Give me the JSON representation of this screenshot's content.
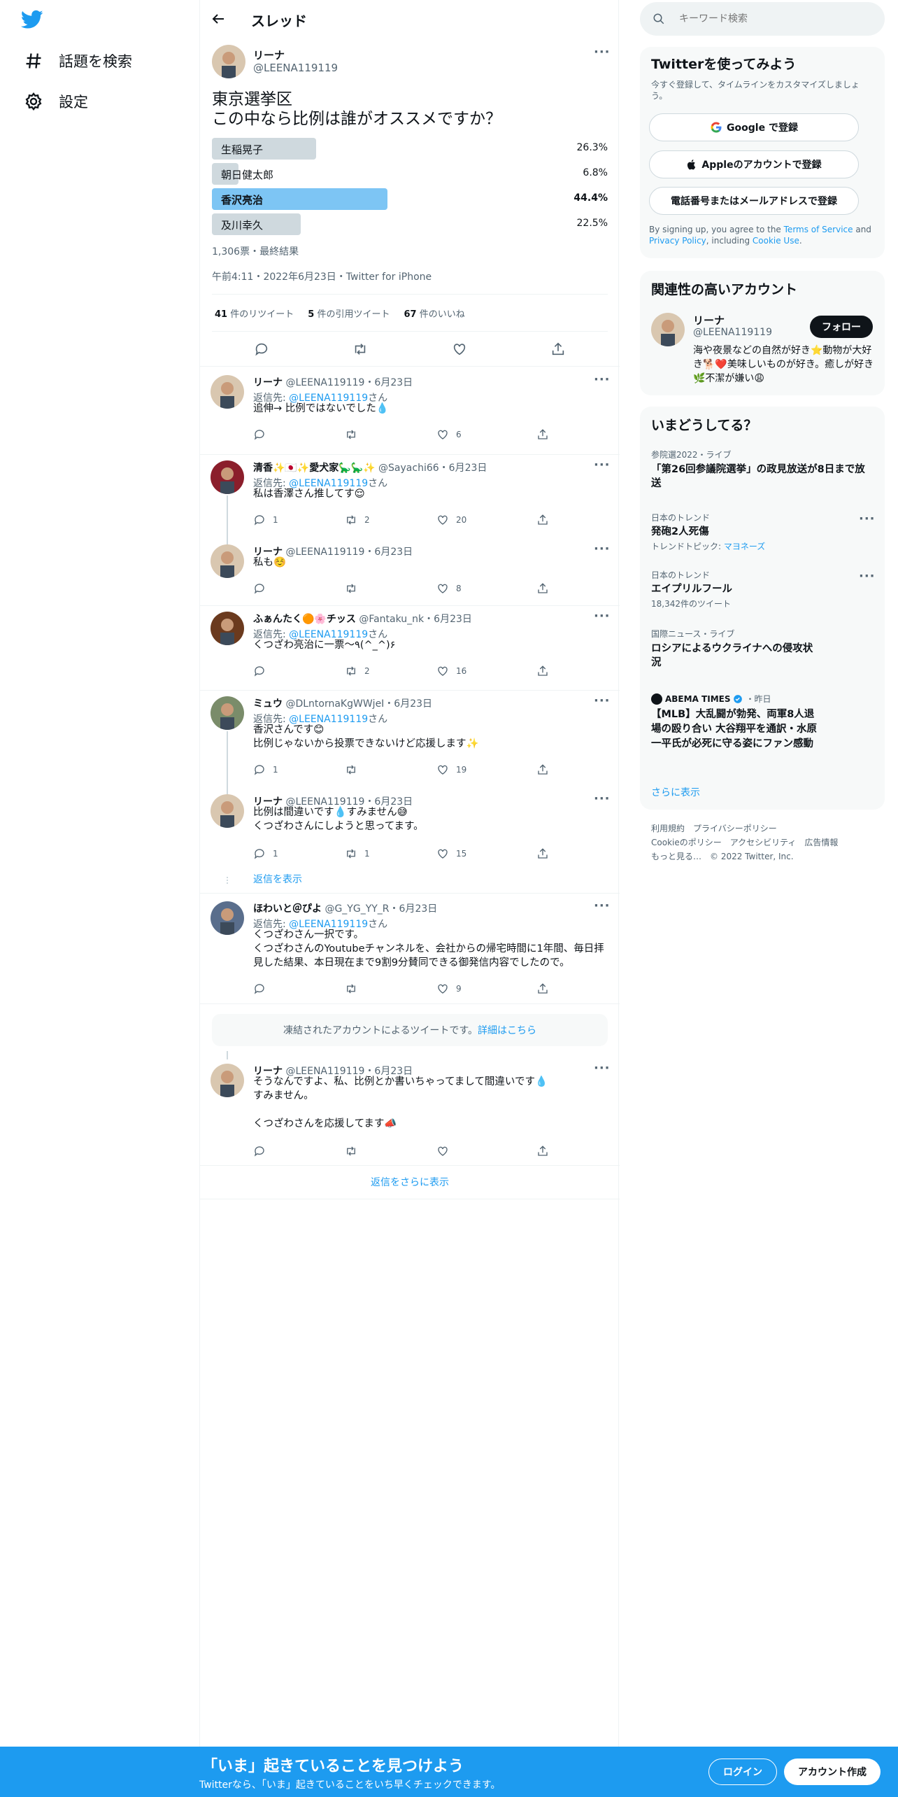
{
  "sidebar": {
    "explore_label": "話題を検索",
    "settings_label": "設定"
  },
  "header": {
    "title": "スレッド"
  },
  "focal": {
    "name": "リーナ",
    "handle": "@LEENA119119",
    "text_line1": "東京選挙区",
    "text_line2": "この中なら比例は誰がオススメですか？",
    "poll": [
      {
        "label": "生稲晃子",
        "percent": "26.3%",
        "value": 26.3,
        "winner": false
      },
      {
        "label": "朝日健太郎",
        "percent": "6.8%",
        "value": 6.8,
        "winner": false
      },
      {
        "label": "香沢亮治",
        "percent": "44.4%",
        "value": 44.4,
        "winner": true
      },
      {
        "label": "及川幸久",
        "percent": "22.5%",
        "value": 22.5,
        "winner": false
      }
    ],
    "votes": "1,306票・最終結果",
    "timestamp": "午前4:11・2022年6月23日・Twitter for iPhone",
    "retweets_count": "41",
    "retweets_label": "件のリツイート",
    "quotes_count": "5",
    "quotes_label": "件の引用ツイート",
    "likes_count": "67",
    "likes_label": "件のいいね"
  },
  "replies": [
    {
      "name": "リーナ",
      "handle": "@LEENA119119",
      "date": "・6月23日",
      "reply_prefix": "返信先: ",
      "reply_to": "@LEENA119119",
      "reply_suffix": "さん",
      "text": "追伸→ 比例ではないでした💧",
      "replies": "",
      "retweets": "",
      "likes": "6"
    },
    {
      "name": "清香✨🇯🇵✨愛犬家🦕🦕✨",
      "handle": "@Sayachi66",
      "date": "・6月23日",
      "reply_prefix": "返信先: ",
      "reply_to": "@LEENA119119",
      "reply_suffix": "さん",
      "text": "私は香澤さん推してす😌",
      "replies": "1",
      "retweets": "2",
      "likes": "20"
    },
    {
      "name": "リーナ",
      "handle": "@LEENA119119",
      "date": "・6月23日",
      "text": "私も☺️",
      "replies": "",
      "retweets": "",
      "likes": "8"
    },
    {
      "name": "ふぁんたく🟠🌸チッス",
      "handle": "@Fantaku_nk",
      "date": "・6月23日",
      "reply_prefix": "返信先: ",
      "reply_to": "@LEENA119119",
      "reply_suffix": "さん",
      "text": "くつざわ亮治に一票〜٩(^_^)۶",
      "replies": "",
      "retweets": "2",
      "likes": "16"
    },
    {
      "name": "ミュウ",
      "handle": "@DLntornaKgWWjeI",
      "date": "・6月23日",
      "reply_prefix": "返信先: ",
      "reply_to": "@LEENA119119",
      "reply_suffix": "さん",
      "text": "香沢さんです😊\n比例じゃないから投票できないけど応援します✨",
      "replies": "1",
      "retweets": "",
      "likes": "19"
    },
    {
      "name": "リーナ",
      "handle": "@LEENA119119",
      "date": "・6月23日",
      "text": "比例は間違いです💧すみません😅\nくつざわさんにしようと思ってます。",
      "replies": "1",
      "retweets": "1",
      "likes": "15"
    },
    {
      "name": "ほわいと＠ぴよ",
      "handle": "@G_YG_YY_R",
      "date": "・6月23日",
      "reply_prefix": "返信先: ",
      "reply_to": "@LEENA119119",
      "reply_suffix": "さん",
      "text": "くつざわさん一択です。\nくつざわさんのYoutubeチャンネルを、会社からの帰宅時間に1年間、毎日拝見した結果、本日現在まで9割9分賛同できる御発信内容でしたので。",
      "replies": "",
      "retweets": "",
      "likes": "9"
    },
    {
      "name": "リーナ",
      "handle": "@LEENA119119",
      "date": "・6月23日",
      "text": "そうなんですよ、私、比例とか書いちゃってまして間違いです💧\nすみません。\n\nくつざわさんを応援してます📣",
      "replies": "",
      "retweets": "",
      "likes": ""
    }
  ],
  "show_replies": "返信を表示",
  "frozen_notice": "凍結されたアカウントによるツイートです。",
  "frozen_link": "詳細はこちら",
  "more_replies": "返信をさらに表示",
  "right": {
    "search_placeholder": "キーワード検索",
    "signup_title": "Twitterを使ってみよう",
    "signup_sub": "今すぐ登録して、タイムラインをカスタマイズしましょう。",
    "google_btn": "Google で登録",
    "apple_btn": "Appleのアカウントで登録",
    "phone_btn": "電話番号またはメールアドレスで登録",
    "tos_1": "By signing up, you agree to the ",
    "tos_link1": "Terms of Service",
    "tos_2": " and ",
    "tos_link2": "Privacy Policy",
    "tos_3": ", including ",
    "tos_link3": "Cookie Use",
    "tos_4": ".",
    "related_title": "関連性の高いアカウント",
    "related_name": "リーナ",
    "related_handle": "@LEENA119119",
    "follow_btn": "フォロー",
    "related_bio": "海や夜景などの自然が好き⭐️動物が大好き🐕❤️美味しいものが好き。癒しが好き🌿不潔が嫌い😩",
    "happening_title": "いまどうしてる？",
    "trends": [
      {
        "ctx": "参院選2022・ライブ",
        "title": "「第26回参議院選挙」の政見放送が8日まで放送",
        "sub": ""
      },
      {
        "ctx": "日本のトレンド",
        "title": "発砲2人死傷",
        "sub_prefix": "トレンドトピック: ",
        "sub_link": "マヨネーズ"
      },
      {
        "ctx": "日本のトレンド",
        "title": "エイプリルフール",
        "sub": "18,342件のツイート"
      },
      {
        "ctx": "国際ニュース・ライブ",
        "title": "ロシアによるウクライナへの侵攻状況",
        "sub": ""
      },
      {
        "ctx_src": "ABEMA TIMES",
        "ctx_time": "・昨日",
        "title": "【MLB】大乱闘が勃発、両軍8人退場の殴り合い 大谷翔平を通訳・水原一平氏が必死に守る姿にファン感動"
      }
    ],
    "show_more": "さらに表示",
    "footer_line1": "利用規約　プライバシーポリシー",
    "footer_line2": "Cookieのポリシー　アクセシビリティ　広告情報",
    "footer_line3": "もっと見る…　© 2022 Twitter, Inc."
  },
  "bottom": {
    "headline": "「いま」起きていることを見つけよう",
    "sub": "Twitterなら、「いま」起きていることをいち早くチェックできます。",
    "login": "ログイン",
    "signup": "アカウント作成"
  },
  "colors": {
    "accent": "#1d9bf0",
    "poll_winner": "#7dc5f4",
    "poll_other": "#cfd9de"
  }
}
